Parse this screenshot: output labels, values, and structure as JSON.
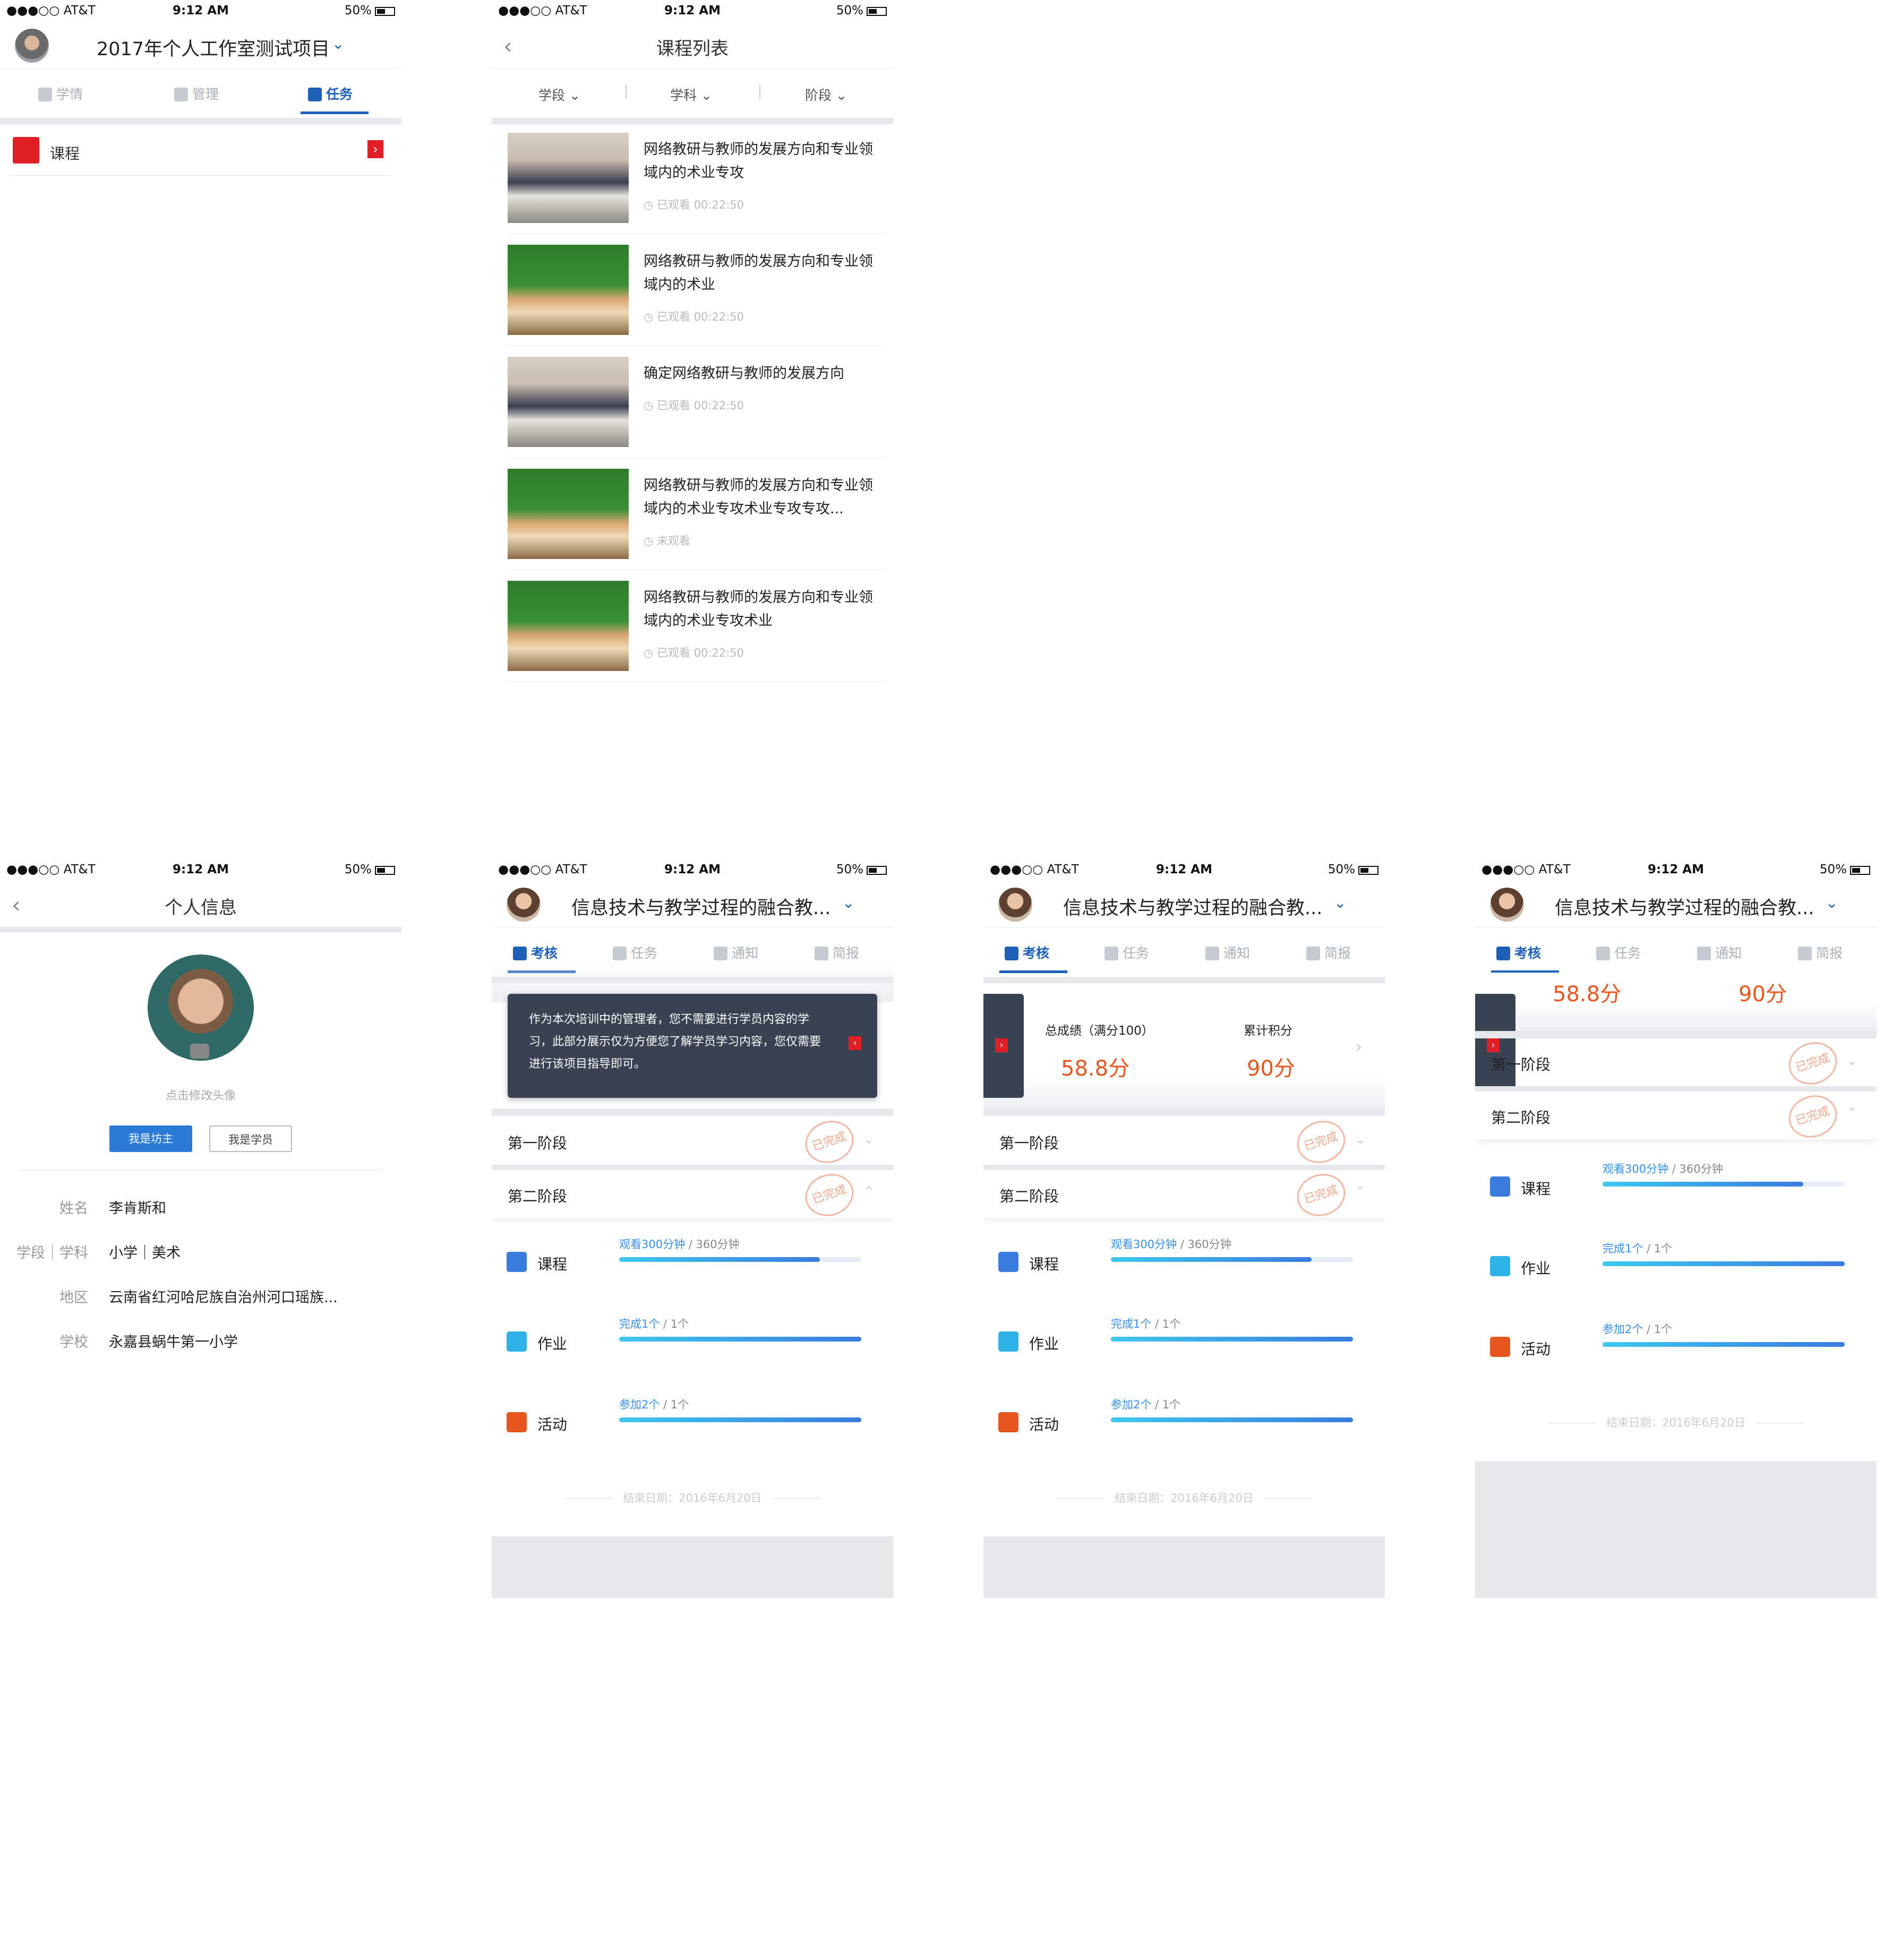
{
  "status": {
    "carrier": "●●●○○ AT&T",
    "time": "9:12 AM",
    "battery": "50%"
  },
  "screen1": {
    "title": "2017年个人工作室测试项目",
    "tabs": [
      {
        "label": "学情"
      },
      {
        "label": "管理"
      },
      {
        "label": "任务"
      }
    ],
    "row": {
      "label": "课程"
    }
  },
  "screen2": {
    "title": "课程列表",
    "filters": [
      "学段 ⌄",
      "学科 ⌄",
      "阶段 ⌄"
    ],
    "items": [
      {
        "title": "网络教研与教师的发展方向和专业领域内的术业专攻",
        "meta": "已观看 00:22:50",
        "thumb": "class"
      },
      {
        "title": "网络教研与教师的发展方向和专业领域内的术业",
        "meta": "已观看 00:22:50",
        "thumb": "kids"
      },
      {
        "title": "确定网络教研与教师的发展方向",
        "meta": "已观看 00:22:50",
        "thumb": "class"
      },
      {
        "title": "网络教研与教师的发展方向和专业领域内的术业专攻术业专攻专攻...",
        "meta": "未观看",
        "thumb": "kids"
      },
      {
        "title": "网络教研与教师的发展方向和专业领域内的术业专攻术业",
        "meta": "已观看 00:22:50",
        "thumb": "kids"
      }
    ]
  },
  "screen3": {
    "title": "个人信息",
    "avatar_hint": "点击修改头像",
    "btn_primary": "我是坊主",
    "btn_secondary": "我是学员",
    "fields": [
      {
        "key": "姓名",
        "value": "李肯斯和"
      },
      {
        "key": "学段｜学科",
        "value": "小学｜美术"
      },
      {
        "key": "地区",
        "value": "云南省红河哈尼族自治州河口瑶族..."
      },
      {
        "key": "学校",
        "value": "永嘉县蜗牛第一小学"
      }
    ]
  },
  "project": {
    "title": "信息技术与教学过程的融合教...",
    "tabs": [
      {
        "label": "考核"
      },
      {
        "label": "任务"
      },
      {
        "label": "通知"
      },
      {
        "label": "简报"
      }
    ],
    "tip": "作为本次培训中的管理者，您不需要进行学员内容的学习，此部分展示仅为方便您了解学员学习内容，您仅需要进行该项目指导即可。",
    "score_label": "总成绩（满分100）",
    "points_label": "累计积分",
    "score": "58.8分",
    "points": "90分",
    "stage1": "第一阶段",
    "stage2": "第二阶段",
    "stamp": "已完成",
    "progress": [
      {
        "name": "课程",
        "done": "观看300分钟",
        "total": " / 360分钟",
        "ratio": 0.83,
        "icon_color": "#3a7bde"
      },
      {
        "name": "作业",
        "done": "完成1个",
        "total": " / 1个",
        "ratio": 1.0,
        "icon_color": "#2fb2e8"
      },
      {
        "name": "活动",
        "done": "参加2个",
        "total": " / 1个",
        "ratio": 1.0,
        "icon_color": "#e8561f"
      }
    ],
    "end_date": "结束日期：2016年6月20日"
  },
  "colors": {
    "accent": "#1e5fb8",
    "score": "#e8561f",
    "red": "#e01e26"
  }
}
